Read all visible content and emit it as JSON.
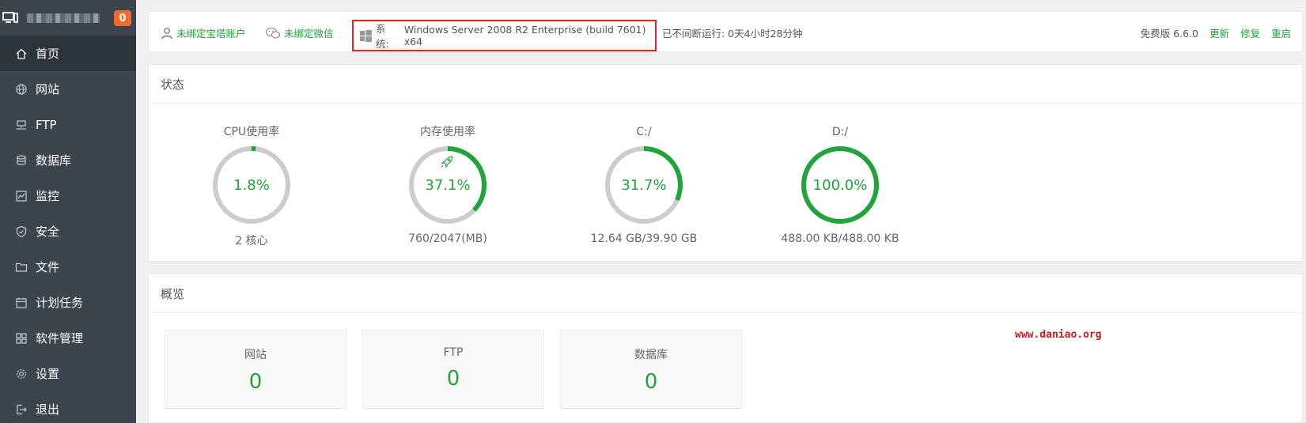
{
  "sidebar": {
    "badge": "0",
    "items": [
      {
        "label": "首页",
        "icon": "home-icon",
        "active": true
      },
      {
        "label": "网站",
        "icon": "globe-icon"
      },
      {
        "label": "FTP",
        "icon": "ftp-icon"
      },
      {
        "label": "数据库",
        "icon": "database-icon"
      },
      {
        "label": "监控",
        "icon": "monitor-icon"
      },
      {
        "label": "安全",
        "icon": "shield-icon"
      },
      {
        "label": "文件",
        "icon": "folder-icon"
      },
      {
        "label": "计划任务",
        "icon": "calendar-icon"
      },
      {
        "label": "软件管理",
        "icon": "grid-icon"
      },
      {
        "label": "设置",
        "icon": "gear-icon"
      },
      {
        "label": "退出",
        "icon": "logout-icon"
      }
    ]
  },
  "topbar": {
    "bind_account": "未绑定宝塔账户",
    "bind_wechat": "未绑定微信",
    "system_label": "系统:",
    "system_value": "Windows Server 2008 R2 Enterprise (build 7601) x64",
    "uptime": "已不间断运行: 0天4小时28分钟",
    "version": "免费版 6.6.0",
    "update": "更新",
    "repair": "修复",
    "restart": "重启"
  },
  "status": {
    "title": "状态",
    "gauges": [
      {
        "title": "CPU使用率",
        "value": "1.8%",
        "percent": 1.8,
        "sub": "2 核心"
      },
      {
        "title": "内存使用率",
        "value": "37.1%",
        "percent": 37.1,
        "sub": "760/2047(MB)",
        "icon": "rocket-icon"
      },
      {
        "title": "C:/",
        "value": "31.7%",
        "percent": 31.7,
        "sub": "12.64 GB/39.90 GB"
      },
      {
        "title": "D:/",
        "value": "100.0%",
        "percent": 100.0,
        "sub": "488.00 KB/488.00 KB"
      }
    ]
  },
  "overview": {
    "title": "概览",
    "cards": [
      {
        "label": "网站",
        "value": "0"
      },
      {
        "label": "FTP",
        "value": "0"
      },
      {
        "label": "数据库",
        "value": "0"
      }
    ],
    "watermark": "www.daniao.org"
  },
  "colors": {
    "accent": "#20a53a",
    "sidebar_bg": "#3c444d",
    "sidebar_active": "#2d343a",
    "badge": "#f16b2c",
    "highlight_box": "#e32323",
    "gauge_track": "#cccccc"
  }
}
